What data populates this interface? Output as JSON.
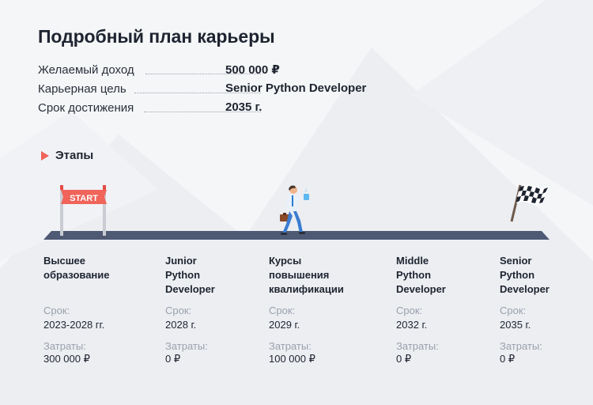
{
  "title": "Подробный план карьеры",
  "summary": [
    {
      "label": "Желаемый доход",
      "value": "500 000 ₽"
    },
    {
      "label": "Карьерная цель",
      "value": "Senior Python Developer"
    },
    {
      "label": "Срок достижения",
      "value": "2035 г."
    }
  ],
  "stages_heading": "Этапы",
  "start_sign_text": "START",
  "stages": [
    {
      "name_lines": [
        "Высшее",
        "образование"
      ],
      "term_label": "Срок:",
      "term": "2023-2028 гг.",
      "cost_label": "Затраты:",
      "cost": "300 000 ₽"
    },
    {
      "name_lines": [
        "Junior",
        "Python",
        "Developer"
      ],
      "term_label": "Срок:",
      "term": "2028 г.",
      "cost_label": "Затраты:",
      "cost": "0 ₽"
    },
    {
      "name_lines": [
        "Курсы",
        "повышения",
        "квалификации"
      ],
      "term_label": "Срок:",
      "term": "2029 г.",
      "cost_label": "Затраты:",
      "cost": "100 000 ₽"
    },
    {
      "name_lines": [
        "Middle",
        "Python",
        "Developer"
      ],
      "term_label": "Срок:",
      "term": "2032 г.",
      "cost_label": "Затраты:",
      "cost": "0 ₽"
    },
    {
      "name_lines": [
        "Senior",
        "Python",
        "Developer"
      ],
      "term_label": "Срок:",
      "term": "2035 г.",
      "cost_label": "Затраты:",
      "cost": "0 ₽"
    }
  ],
  "colors": {
    "accent": "#f0645a",
    "road": "#4e5974",
    "text": "#1e2430",
    "muted": "#9aa1ad"
  }
}
